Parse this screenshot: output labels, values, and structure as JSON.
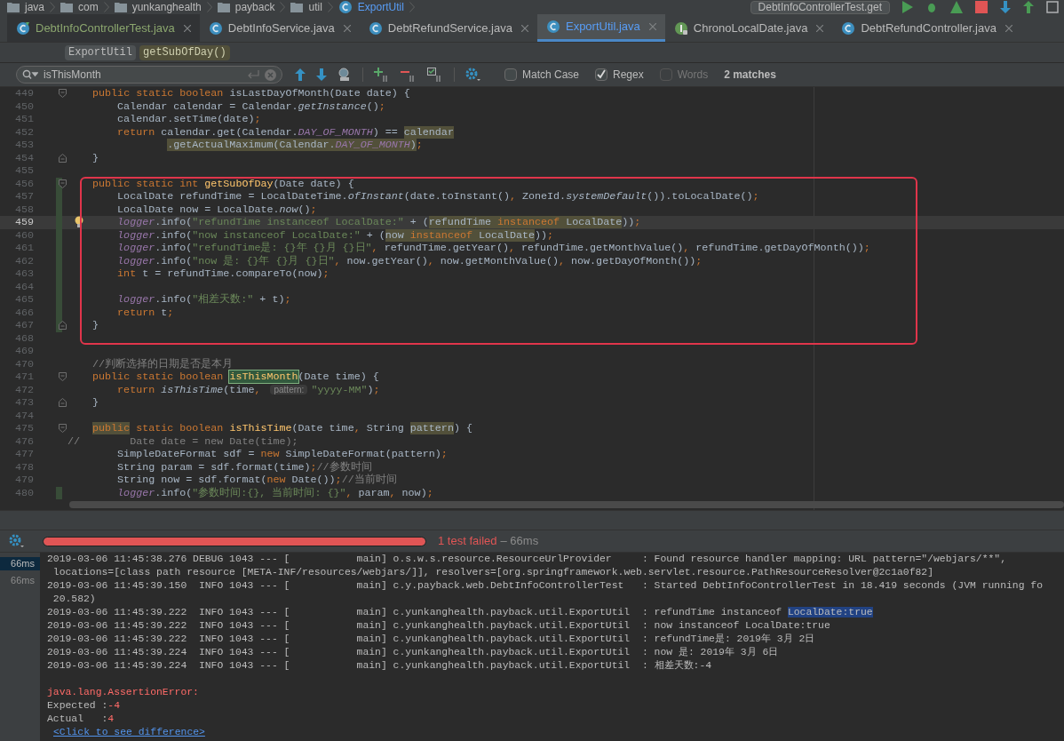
{
  "breadcrumb": [
    {
      "label": "java",
      "kind": "folder"
    },
    {
      "label": "com",
      "kind": "folder"
    },
    {
      "label": "yunkanghealth",
      "kind": "folder"
    },
    {
      "label": "payback",
      "kind": "folder"
    },
    {
      "label": "util",
      "kind": "folder"
    },
    {
      "label": "ExportUtil",
      "kind": "class"
    }
  ],
  "run_config": "DebtInfoControllerTest.get",
  "tabs": [
    {
      "label": "DebtInfoControllerTest.java",
      "kind": "test",
      "selected": false
    },
    {
      "label": "DebtInfoService.java",
      "kind": "class",
      "selected": false
    },
    {
      "label": "DebtRefundService.java",
      "kind": "class",
      "selected": false
    },
    {
      "label": "ExportUtil.java",
      "kind": "class",
      "selected": true
    },
    {
      "label": "ChronoLocalDate.java",
      "kind": "interface",
      "selected": false
    },
    {
      "label": "DebtRefundController.java",
      "kind": "class",
      "selected": false
    }
  ],
  "structure_path": [
    {
      "label": "ExportUtil",
      "kind": "class"
    },
    {
      "label": "getSubOfDay()",
      "kind": "method"
    }
  ],
  "search": {
    "value": "isThisMonth",
    "options": [
      {
        "label": "Match Case",
        "checked": false,
        "disabled": false
      },
      {
        "label": "Regex",
        "checked": true,
        "disabled": false
      },
      {
        "label": "Words",
        "checked": false,
        "disabled": true
      }
    ],
    "result": "2 matches"
  },
  "editor": {
    "lines": [
      {
        "n": "449",
        "changed": false,
        "current": false,
        "fold_start": true,
        "segs": [
          {
            "t": "    public static boolean ",
            "kind": "keyword"
          },
          {
            "t": "isLastDayOfMonth(Date date) {"
          }
        ]
      },
      {
        "n": "450",
        "changed": false,
        "current": false,
        "segs": [
          {
            "t": "        Calendar calendar = Calendar."
          },
          {
            "t": "getInstance",
            "kind": "italic"
          },
          {
            "t": "()"
          },
          {
            "t": ";",
            "kind": "keyword"
          }
        ]
      },
      {
        "n": "451",
        "changed": false,
        "current": false,
        "segs": [
          {
            "t": "        calendar.setTime(date)"
          },
          {
            "t": ";",
            "kind": "keyword"
          }
        ]
      },
      {
        "n": "452",
        "changed": false,
        "current": false,
        "segs": [
          {
            "t": "        return ",
            "kind": "keyword"
          },
          {
            "t": "calendar.get(Calendar."
          },
          {
            "t": "DAY_OF_MONTH",
            "kind": "field"
          },
          {
            "t": ") == "
          },
          {
            "t": "calendar",
            "kind": "highlight"
          }
        ]
      },
      {
        "n": "453",
        "changed": false,
        "current": false,
        "segs": [
          {
            "t": "                .getActualMaximum(Calendar.",
            "kind": "highlight"
          },
          {
            "t": "DAY_OF_MONTH",
            "kind": "highlight-field"
          },
          {
            "t": ")",
            "kind": "highlight"
          },
          {
            "t": ";",
            "kind": "keyword"
          }
        ]
      },
      {
        "n": "454",
        "changed": false,
        "current": false,
        "fold_end": true,
        "segs": [
          {
            "t": "    }"
          }
        ]
      },
      {
        "n": "455",
        "changed": false,
        "current": false
      },
      {
        "n": "456",
        "changed": true,
        "current": false,
        "fold_start": true,
        "segs": [
          {
            "t": "    public static int ",
            "kind": "keyword"
          },
          {
            "t": "getSubOfDay",
            "kind": "declaration"
          },
          {
            "t": "(Date date) {"
          }
        ]
      },
      {
        "n": "457",
        "changed": true,
        "current": false,
        "segs": [
          {
            "t": "        LocalDate refundTime = LocalDateTime."
          },
          {
            "t": "ofInstant",
            "kind": "italic"
          },
          {
            "t": "(date.toInstant()"
          },
          {
            "t": ", ",
            "kind": "keyword"
          },
          {
            "t": "ZoneId."
          },
          {
            "t": "systemDefault",
            "kind": "italic"
          },
          {
            "t": "()).toLocalDate()"
          },
          {
            "t": ";",
            "kind": "keyword"
          }
        ]
      },
      {
        "n": "458",
        "changed": true,
        "current": false,
        "segs": [
          {
            "t": "        LocalDate now = LocalDate."
          },
          {
            "t": "now",
            "kind": "italic"
          },
          {
            "t": "()"
          },
          {
            "t": ";",
            "kind": "keyword"
          }
        ]
      },
      {
        "n": "459",
        "changed": true,
        "current": true,
        "bulb": true,
        "segs": [
          {
            "t": "        logger",
            "kind": "field"
          },
          {
            "t": ".info("
          },
          {
            "t": "\"refundTime instanceof LocalDate:\"",
            "kind": "string"
          },
          {
            "t": " + ("
          },
          {
            "t": "refundTime ",
            "kind": "highlight"
          },
          {
            "t": "instanceof ",
            "kind": "highlight-keyword"
          },
          {
            "t": "LocalDate",
            "kind": "highlight"
          },
          {
            "t": "))"
          },
          {
            "t": ";",
            "kind": "keyword"
          }
        ]
      },
      {
        "n": "460",
        "changed": true,
        "current": false,
        "segs": [
          {
            "t": "        logger",
            "kind": "field"
          },
          {
            "t": ".info("
          },
          {
            "t": "\"now instanceof LocalDate:\"",
            "kind": "string"
          },
          {
            "t": " + ("
          },
          {
            "t": "now ",
            "kind": "highlight"
          },
          {
            "t": "instanceof ",
            "kind": "highlight-keyword"
          },
          {
            "t": "LocalDate",
            "kind": "highlight"
          },
          {
            "t": "))"
          },
          {
            "t": ";",
            "kind": "keyword"
          }
        ]
      },
      {
        "n": "461",
        "changed": true,
        "current": false,
        "segs": [
          {
            "t": "        logger",
            "kind": "field"
          },
          {
            "t": ".info("
          },
          {
            "t": "\"refundTime是: {}年 {}月 {}日\"",
            "kind": "string"
          },
          {
            "t": ", ",
            "kind": "keyword"
          },
          {
            "t": "refundTime.getYear()"
          },
          {
            "t": ", ",
            "kind": "keyword"
          },
          {
            "t": "refundTime.getMonthValue()"
          },
          {
            "t": ", ",
            "kind": "keyword"
          },
          {
            "t": "refundTime.getDayOfMonth())"
          },
          {
            "t": ";",
            "kind": "keyword"
          }
        ]
      },
      {
        "n": "462",
        "changed": true,
        "current": false,
        "segs": [
          {
            "t": "        logger",
            "kind": "field"
          },
          {
            "t": ".info("
          },
          {
            "t": "\"now 是: {}年 {}月 {}日\"",
            "kind": "string"
          },
          {
            "t": ", ",
            "kind": "keyword"
          },
          {
            "t": "now.getYear()"
          },
          {
            "t": ", ",
            "kind": "keyword"
          },
          {
            "t": "now.getMonthValue()"
          },
          {
            "t": ", ",
            "kind": "keyword"
          },
          {
            "t": "now.getDayOfMonth())"
          },
          {
            "t": ";",
            "kind": "keyword"
          }
        ]
      },
      {
        "n": "463",
        "changed": true,
        "current": false,
        "segs": [
          {
            "t": "        int ",
            "kind": "keyword"
          },
          {
            "t": "t = refundTime.compareTo(now)"
          },
          {
            "t": ";",
            "kind": "keyword"
          }
        ]
      },
      {
        "n": "464",
        "changed": true,
        "current": false
      },
      {
        "n": "465",
        "changed": true,
        "current": false,
        "segs": [
          {
            "t": "        logger",
            "kind": "field"
          },
          {
            "t": ".info("
          },
          {
            "t": "\"相差天数:\"",
            "kind": "string"
          },
          {
            "t": " + t)"
          },
          {
            "t": ";",
            "kind": "keyword"
          }
        ]
      },
      {
        "n": "466",
        "changed": true,
        "current": false,
        "segs": [
          {
            "t": "        return ",
            "kind": "keyword"
          },
          {
            "t": "t"
          },
          {
            "t": ";",
            "kind": "keyword"
          }
        ]
      },
      {
        "n": "467",
        "changed": true,
        "current": false,
        "fold_end": true,
        "segs": [
          {
            "t": "    }"
          }
        ]
      },
      {
        "n": "468",
        "changed": false,
        "current": false
      },
      {
        "n": "469",
        "changed": false,
        "current": false
      },
      {
        "n": "470",
        "changed": false,
        "current": false,
        "segs": [
          {
            "t": "    //判断选择的日期是否是本月",
            "kind": "comment"
          }
        ]
      },
      {
        "n": "471",
        "changed": false,
        "current": false,
        "fold_start": true,
        "segs": [
          {
            "t": "    public static boolean ",
            "kind": "keyword"
          },
          {
            "t": "isThisMonth",
            "kind": "search-hit"
          },
          {
            "t": "(Date time) {"
          }
        ]
      },
      {
        "n": "472",
        "changed": false,
        "current": false,
        "segs": [
          {
            "t": "        return ",
            "kind": "keyword"
          },
          {
            "t": "isThisTime",
            "kind": "italic"
          },
          {
            "t": "(time"
          },
          {
            "t": ", ",
            "kind": "keyword"
          },
          {
            "t": "pattern:",
            "kind": "hint"
          },
          {
            "t": "\"yyyy-MM\"",
            "kind": "string"
          },
          {
            "t": ")"
          },
          {
            "t": ";",
            "kind": "keyword"
          }
        ]
      },
      {
        "n": "473",
        "changed": false,
        "current": false,
        "fold_end": true,
        "segs": [
          {
            "t": "    }"
          }
        ]
      },
      {
        "n": "474",
        "changed": false,
        "current": false
      },
      {
        "n": "475",
        "changed": false,
        "current": false,
        "fold_start": true,
        "segs": [
          {
            "t": "    public",
            "kind": "highlight-keyword"
          },
          {
            "t": " static boolean ",
            "kind": "keyword"
          },
          {
            "t": "isThisTime",
            "kind": "declaration"
          },
          {
            "t": "(Date time"
          },
          {
            "t": ", ",
            "kind": "keyword"
          },
          {
            "t": "String "
          },
          {
            "t": "pattern",
            "kind": "highlight"
          },
          {
            "t": ") {"
          }
        ]
      },
      {
        "n": "476",
        "changed": false,
        "current": false,
        "segs": [
          {
            "t": "//        Date date = new Date(time);",
            "kind": "comment"
          }
        ]
      },
      {
        "n": "477",
        "changed": false,
        "current": false,
        "segs": [
          {
            "t": "        SimpleDateFormat sdf = "
          },
          {
            "t": "new ",
            "kind": "keyword"
          },
          {
            "t": "SimpleDateFormat(pattern)"
          },
          {
            "t": ";",
            "kind": "keyword"
          }
        ]
      },
      {
        "n": "478",
        "changed": false,
        "current": false,
        "segs": [
          {
            "t": "        String param = sdf.format(time)"
          },
          {
            "t": ";",
            "kind": "keyword"
          },
          {
            "t": "//参数时间",
            "kind": "comment"
          }
        ]
      },
      {
        "n": "479",
        "changed": false,
        "current": false,
        "segs": [
          {
            "t": "        String now = sdf.format("
          },
          {
            "t": "new ",
            "kind": "keyword"
          },
          {
            "t": "Date())"
          },
          {
            "t": ";",
            "kind": "keyword"
          },
          {
            "t": "//当前时间",
            "kind": "comment"
          }
        ]
      },
      {
        "n": "480",
        "changed": true,
        "current": false,
        "segs": [
          {
            "t": "        logger",
            "kind": "field"
          },
          {
            "t": ".info("
          },
          {
            "t": "\"参数时间:{}, 当前时间: {}\"",
            "kind": "string"
          },
          {
            "t": ", ",
            "kind": "keyword"
          },
          {
            "t": "param"
          },
          {
            "t": ", ",
            "kind": "keyword"
          },
          {
            "t": "now)"
          },
          {
            "t": ";",
            "kind": "keyword"
          }
        ]
      }
    ]
  },
  "test_run": {
    "progress": {
      "level": 1,
      "failed": true
    },
    "status": "1 test failed",
    "duration": "– 66ms"
  },
  "test_tree": [
    {
      "label": "66ms",
      "selected": true
    },
    {
      "label": "66ms",
      "selected": false
    }
  ],
  "console": [
    {
      "kind": "log",
      "segs": [
        {
          "t": "2019-03-06 11:45:38.276 DEBUG 1043 --- [           main] o.s.w.s.resource.ResourceUrlProvider     : Found resource handler mapping: URL pattern=\"/webjars/**\","
        }
      ]
    },
    {
      "kind": "log",
      "segs": [
        {
          "t": " locations=[class path resource [META-INF/resources/webjars/]], resolvers=[org.springframework.web.servlet.resource.PathResourceResolver@2c1a0f82]"
        }
      ]
    },
    {
      "kind": "log",
      "segs": [
        {
          "t": "2019-03-06 11:45:39.150  INFO 1043 --- [           main] c.y.payback.web.DebtInfoControllerTest   : Started DebtInfoControllerTest in 18.419 seconds (JVM running fo"
        }
      ]
    },
    {
      "kind": "log",
      "segs": [
        {
          "t": " 20.582)"
        }
      ]
    },
    {
      "kind": "log",
      "segs": [
        {
          "t": "2019-03-06 11:45:39.222  INFO 1043 --- [           main] c.yunkanghealth.payback.util.ExportUtil  : refundTime instanceof "
        },
        {
          "t": "LocalDate:true",
          "kind": "selection"
        }
      ]
    },
    {
      "kind": "log",
      "segs": [
        {
          "t": "2019-03-06 11:45:39.222  INFO 1043 --- [           main] c.yunkanghealth.payback.util.ExportUtil  : now instanceof LocalDate:true"
        }
      ]
    },
    {
      "kind": "log",
      "segs": [
        {
          "t": "2019-03-06 11:45:39.222  INFO 1043 --- [           main] c.yunkanghealth.payback.util.ExportUtil  : refundTime是: 2019年 3月 2日"
        }
      ]
    },
    {
      "kind": "log",
      "segs": [
        {
          "t": "2019-03-06 11:45:39.224  INFO 1043 --- [           main] c.yunkanghealth.payback.util.ExportUtil  : now 是: 2019年 3月 6日"
        }
      ]
    },
    {
      "kind": "log",
      "segs": [
        {
          "t": "2019-03-06 11:45:39.224  INFO 1043 --- [           main] c.yunkanghealth.payback.util.ExportUtil  : 相差天数:-4"
        }
      ]
    },
    {
      "kind": "blank"
    },
    {
      "kind": "error",
      "segs": [
        {
          "t": "java.lang.AssertionError:"
        }
      ]
    },
    {
      "kind": "log",
      "segs": [
        {
          "t": "Expected :"
        },
        {
          "t": "-4",
          "kind": "error"
        }
      ]
    },
    {
      "kind": "log",
      "segs": [
        {
          "t": "Actual   :"
        },
        {
          "t": "4",
          "kind": "error"
        }
      ]
    },
    {
      "kind": "link",
      "segs": [
        {
          "t": "<Click to see difference>"
        }
      ]
    }
  ]
}
